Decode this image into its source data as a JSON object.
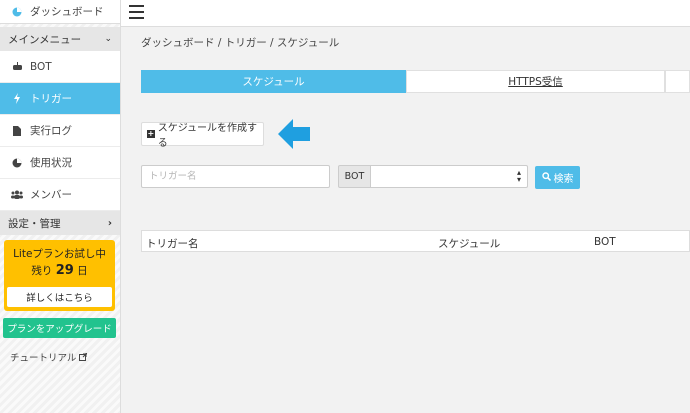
{
  "sidebar": {
    "dashboard": "ダッシュボード",
    "main_menu": "メインメニュー",
    "items": [
      {
        "label": "BOT",
        "icon": "robot-icon"
      },
      {
        "label": "トリガー",
        "icon": "bolt-icon"
      },
      {
        "label": "実行ログ",
        "icon": "file-icon"
      },
      {
        "label": "使用状況",
        "icon": "pie-chart-icon"
      },
      {
        "label": "メンバー",
        "icon": "users-icon"
      }
    ],
    "settings": "設定・管理",
    "trial": {
      "title": "Liteプランお試し中",
      "remaining_prefix": "残り",
      "days": "29",
      "days_suffix": "日",
      "details_button": "詳しくはこちら"
    },
    "upgrade_button": "プランをアップグレード",
    "tutorial": "チュートリアル"
  },
  "breadcrumb": "ダッシュボード / トリガー / スケジュール",
  "tabs": {
    "schedule": "スケジュール",
    "https": "HTTPS受信"
  },
  "create_button": "スケジュールを作成する",
  "filters": {
    "trigger_placeholder": "トリガー名",
    "bot_label": "BOT",
    "search_button": "検索"
  },
  "table": {
    "columns": [
      "トリガー名",
      "スケジュール",
      "BOT"
    ]
  },
  "colors": {
    "accent": "#4fbce8",
    "trial_bg": "#ffc000",
    "upgrade": "#22c38e",
    "arrow": "#1f9fe0"
  }
}
